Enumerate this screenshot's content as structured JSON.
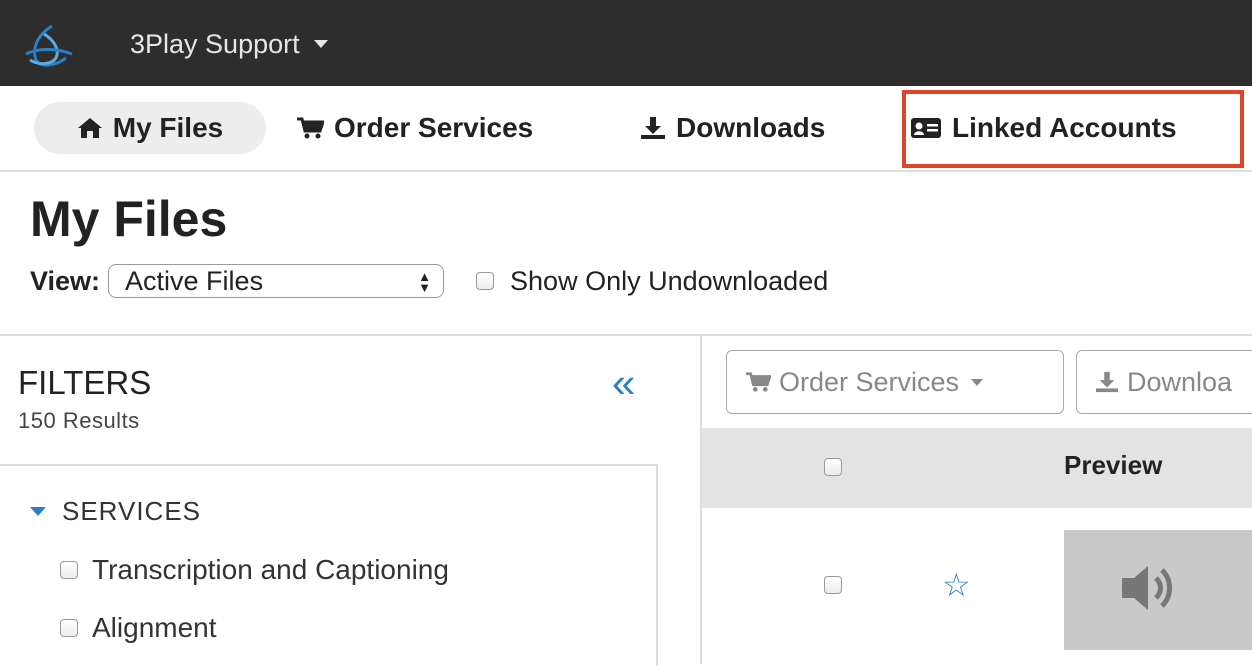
{
  "topbar": {
    "account_name": "3Play Support",
    "logo_icon": "3play-logo-icon"
  },
  "nav": {
    "tabs": [
      {
        "label": "My Files",
        "icon": "home-icon",
        "active": true
      },
      {
        "label": "Order Services",
        "icon": "cart-icon"
      },
      {
        "label": "Downloads",
        "icon": "download-icon"
      },
      {
        "label": "Linked Accounts",
        "icon": "id-card-icon"
      }
    ],
    "highlight_color": "#e0442a"
  },
  "page": {
    "title": "My Files",
    "view_label": "View:",
    "view_selected": "Active Files",
    "show_only_label": "Show Only Undownloaded"
  },
  "filters": {
    "title": "FILTERS",
    "count": "150 Results",
    "collapse_icon": "«",
    "section": "SERVICES",
    "items": [
      "Transcription and Captioning",
      "Alignment"
    ]
  },
  "toolbar": {
    "order_label": "Order Services",
    "download_label": "Downloa"
  },
  "table": {
    "preview_header": "Preview"
  },
  "colors": {
    "accent": "#2b7fc5",
    "topbar": "#2d2d2d"
  }
}
